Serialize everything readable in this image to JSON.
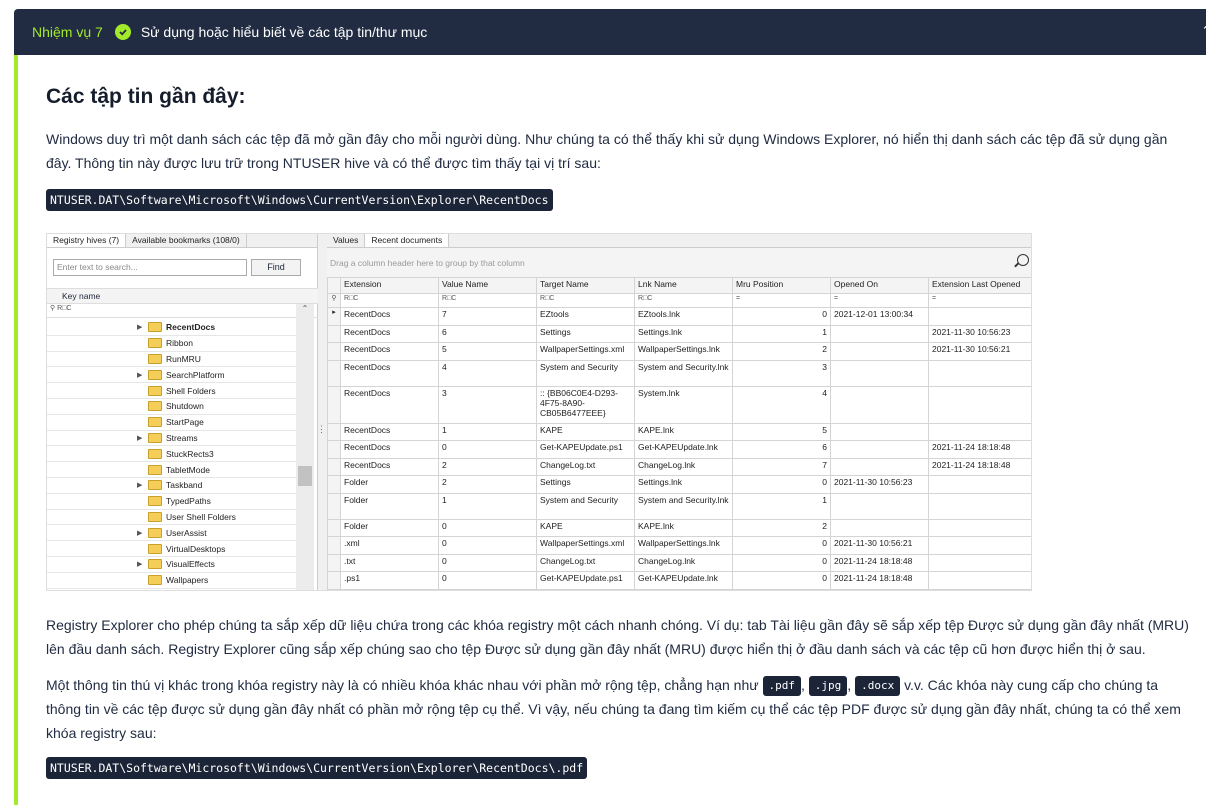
{
  "task": {
    "number": "Nhiệm vụ 7",
    "title": "Sử dụng hoặc hiểu biết về các tập tin/thư mục"
  },
  "heading": "Các tập tin gần đây:",
  "para1": "Windows duy trì một danh sách các tệp đã mở gần đây cho mỗi người dùng. Như chúng ta có thể thấy khi sử dụng Windows Explorer, nó hiển thị danh sách các tệp đã sử dụng gần đây. Thông tin này được lưu trữ trong NTUSER hive và có thể được tìm thấy tại vị trí sau:",
  "code1": "NTUSER.DAT\\Software\\Microsoft\\Windows\\CurrentVersion\\Explorer\\RecentDocs",
  "screenshot": {
    "left_tabs": [
      "Registry hives (7)",
      "Available bookmarks (108/0)"
    ],
    "search_placeholder": "Enter text to search...",
    "find_label": "Find",
    "key_name_header": "Key name",
    "filter_glyph": "R□C",
    "tree": [
      "RecentDocs",
      "Ribbon",
      "RunMRU",
      "SearchPlatform",
      "Shell Folders",
      "Shutdown",
      "StartPage",
      "Streams",
      "StuckRects3",
      "TabletMode",
      "Taskband",
      "TypedPaths",
      "User Shell Folders",
      "UserAssist",
      "VirtualDesktops",
      "VisualEffects",
      "Wallpapers"
    ],
    "tree_arrows": [
      true,
      false,
      false,
      true,
      false,
      false,
      false,
      true,
      false,
      false,
      true,
      false,
      false,
      true,
      false,
      true,
      false
    ],
    "right_tabs": [
      "Values",
      "Recent documents"
    ],
    "group_hint": "Drag a column header here to group by that column",
    "columns": [
      "Extension",
      "Value Name",
      "Target Name",
      "Lnk Name",
      "Mru Position",
      "Opened On",
      "Extension Last Opened"
    ],
    "rows": [
      [
        "RecentDocs",
        "7",
        "EZtools",
        "EZtools.lnk",
        "0",
        "2021-12-01 13:00:34",
        ""
      ],
      [
        "RecentDocs",
        "6",
        "Settings",
        "Settings.lnk",
        "1",
        "",
        "2021-11-30 10:56:23"
      ],
      [
        "RecentDocs",
        "5",
        "WallpaperSettings.xml",
        "WallpaperSettings.lnk",
        "2",
        "",
        "2021-11-30 10:56:21"
      ],
      [
        "RecentDocs",
        "4",
        "System and Security",
        "System and Security.lnk",
        "3",
        "",
        ""
      ],
      [
        "RecentDocs",
        "3",
        ":: {BB06C0E4-D293-4F75-8A90-CB05B6477EEE}",
        "System.lnk",
        "4",
        "",
        ""
      ],
      [
        "RecentDocs",
        "1",
        "KAPE",
        "KAPE.lnk",
        "5",
        "",
        ""
      ],
      [
        "RecentDocs",
        "0",
        "Get-KAPEUpdate.ps1",
        "Get-KAPEUpdate.lnk",
        "6",
        "",
        "2021-11-24 18:18:48"
      ],
      [
        "RecentDocs",
        "2",
        "ChangeLog.txt",
        "ChangeLog.lnk",
        "7",
        "",
        "2021-11-24 18:18:48"
      ],
      [
        "Folder",
        "2",
        "Settings",
        "Settings.lnk",
        "0",
        "2021-11-30 10:56:23",
        ""
      ],
      [
        "Folder",
        "1",
        "System and Security",
        "System and Security.lnk",
        "1",
        "",
        ""
      ],
      [
        "Folder",
        "0",
        "KAPE",
        "KAPE.lnk",
        "2",
        "",
        ""
      ],
      [
        ".xml",
        "0",
        "WallpaperSettings.xml",
        "WallpaperSettings.lnk",
        "0",
        "2021-11-30 10:56:21",
        ""
      ],
      [
        ".txt",
        "0",
        "ChangeLog.txt",
        "ChangeLog.lnk",
        "0",
        "2021-11-24 18:18:48",
        ""
      ],
      [
        ".ps1",
        "0",
        "Get-KAPEUpdate.ps1",
        "Get-KAPEUpdate.lnk",
        "0",
        "2021-11-24 18:18:48",
        ""
      ]
    ]
  },
  "para2": "Registry Explorer cho phép chúng ta sắp xếp dữ liệu chứa trong các khóa registry một cách nhanh chóng. Ví dụ: tab Tài liệu gần đây sẽ sắp xếp tệp Được sử dụng gần đây nhất (MRU) lên đầu danh sách. Registry Explorer cũng sắp xếp chúng sao cho tệp Được sử dụng gần đây nhất (MRU) được hiển thị ở đầu danh sách và các tệp cũ hơn được hiển thị ở sau.",
  "para3_a": "Một thông tin thú vị khác trong khóa registry này là có nhiều khóa khác nhau với phần mở rộng tệp, chẳng hạn như ",
  "ext_pdf": ".pdf",
  "ext_jpg": ".jpg",
  "ext_docx": ".docx",
  "sep": ",",
  "para3_b": " v.v. Các khóa này cung cấp cho chúng ta thông tin về các tệp được sử dụng gần đây nhất có phần mở rộng tệp cụ thể. Vì vậy, nếu chúng ta đang tìm kiếm cụ thể các tệp PDF được sử dụng gần đây nhất, chúng ta có thể xem khóa registry sau:",
  "code2": "NTUSER.DAT\\Software\\Microsoft\\Windows\\CurrentVersion\\Explorer\\RecentDocs\\.pdf"
}
